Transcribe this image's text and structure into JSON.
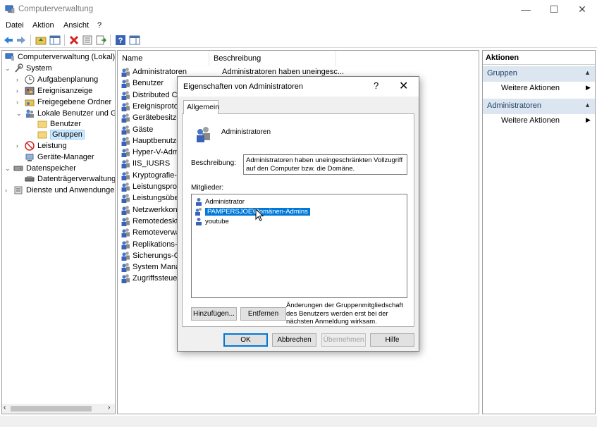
{
  "window": {
    "title": "Computerverwaltung",
    "minimize": "—",
    "maximize": "☐",
    "close": "✕"
  },
  "menu": [
    "Datei",
    "Aktion",
    "Ansicht",
    "?"
  ],
  "tree": [
    {
      "label": "Computerverwaltung (Lokal)",
      "arrow": ""
    },
    {
      "label": "System",
      "arrow": "⌄"
    },
    {
      "label": "Aufgabenplanung",
      "arrow": "›"
    },
    {
      "label": "Ereignisanzeige",
      "arrow": "›"
    },
    {
      "label": "Freigegebene Ordner",
      "arrow": "›"
    },
    {
      "label": "Lokale Benutzer und Gr",
      "arrow": "⌄"
    },
    {
      "label": "Benutzer",
      "arrow": ""
    },
    {
      "label": "Gruppen",
      "arrow": ""
    },
    {
      "label": "Leistung",
      "arrow": "›"
    },
    {
      "label": "Geräte-Manager",
      "arrow": ""
    },
    {
      "label": "Datenspeicher",
      "arrow": "⌄"
    },
    {
      "label": "Datenträgerverwaltung",
      "arrow": ""
    },
    {
      "label": "Dienste und Anwendungen",
      "arrow": "›"
    }
  ],
  "list": {
    "col_name": "Name",
    "col_desc": "Beschreibung",
    "rows": [
      {
        "name": "Administratoren",
        "desc": "Administratoren haben uneingesc..."
      },
      {
        "name": "Benutzer"
      },
      {
        "name": "Distributed CO"
      },
      {
        "name": "Ereignisprotok"
      },
      {
        "name": "Gerätebesitzer"
      },
      {
        "name": "Gäste"
      },
      {
        "name": "Hauptbenutze"
      },
      {
        "name": "Hyper-V-Adm"
      },
      {
        "name": "IIS_IUSRS"
      },
      {
        "name": "Kryptografie-O"
      },
      {
        "name": "Leistungsproto"
      },
      {
        "name": "Leistungsüber"
      },
      {
        "name": "Netzwerkkonfi"
      },
      {
        "name": "Remotedeskto"
      },
      {
        "name": "Remoteverwal"
      },
      {
        "name": "Replikations-O"
      },
      {
        "name": "Sicherungs-Op"
      },
      {
        "name": "System Manag"
      },
      {
        "name": "Zugriffssteuer"
      }
    ]
  },
  "actions": {
    "title": "Aktionen",
    "groups": [
      {
        "label": "Gruppen",
        "item": "Weitere Aktionen"
      },
      {
        "label": "Administratoren",
        "item": "Weitere Aktionen"
      }
    ]
  },
  "dialog": {
    "title": "Eigenschaften von Administratoren",
    "help": "?",
    "close": "✕",
    "tab": "Allgemein",
    "group_name": "Administratoren",
    "desc_label": "Beschreibung:",
    "desc_value": "Administratoren haben uneingeschränkten Vollzugriff auf den Computer bzw. die Domäne.",
    "members_label": "Mitglieder:",
    "members": [
      "Administrator",
      "PAMPERSJOE\\Domänen-Admins",
      "youtube"
    ],
    "add_btn": "Hinzufügen...",
    "remove_btn": "Entfernen",
    "note": "Änderungen der Gruppenmitgliedschaft des Benutzers werden erst bei der nächsten Anmeldung wirksam.",
    "ok": "OK",
    "cancel": "Abbrechen",
    "apply": "Übernehmen",
    "help_btn": "Hilfe"
  },
  "colors": {
    "selection": "#0078d7",
    "accent_group": "#dce6f0",
    "tree_select": "#cce8ff"
  },
  "icons": [
    "app-icon",
    "back-icon",
    "forward-icon",
    "up-folder-icon",
    "show-tree-icon",
    "delete-icon",
    "properties-icon",
    "export-icon",
    "help-icon",
    "pane-icon",
    "group-icon",
    "user-icon",
    "folder-icon"
  ]
}
